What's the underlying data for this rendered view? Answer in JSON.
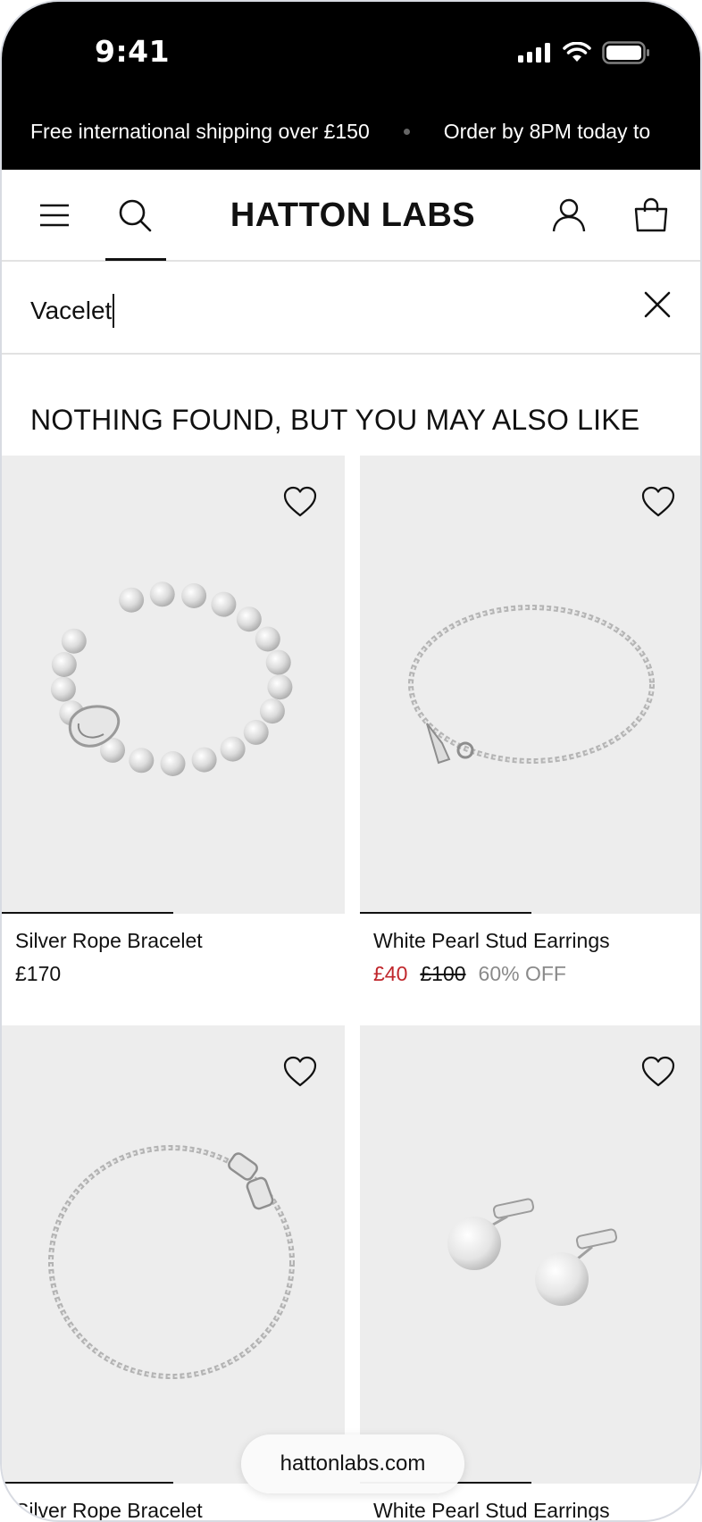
{
  "status_bar": {
    "time": "9:41"
  },
  "promo": {
    "messages": [
      "Free international shipping over £150",
      "Order by 8PM today to"
    ]
  },
  "header": {
    "logo": "HATTON LABS"
  },
  "search": {
    "value": "Vacelet"
  },
  "results": {
    "heading": "NOTHING FOUND, BUT YOU MAY ALSO LIKE"
  },
  "products": [
    {
      "name": "Silver Rope Bracelet",
      "price": "£170",
      "image": "pearl-bracelet"
    },
    {
      "name": "White Pearl Stud Earrings",
      "sale_price": "£40",
      "original_price": "£100",
      "discount": "60% OFF",
      "image": "rope-chain"
    },
    {
      "name": "Silver Rope Bracelet",
      "image": "rope-bracelet-clasp"
    },
    {
      "name": "White Pearl Stud Earrings",
      "image": "pearl-studs"
    }
  ],
  "browser": {
    "url": "hattonlabs.com"
  },
  "colors": {
    "sale": "#c0262b",
    "discount": "#8a8a8a",
    "image_bg": "#ededed"
  }
}
